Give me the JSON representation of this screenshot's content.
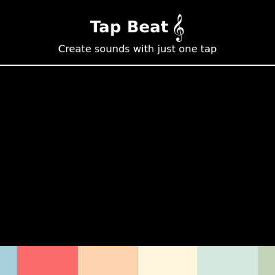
{
  "header": {
    "title": "Tap Beat",
    "clef_glyph": "𝄞",
    "clef_icon": "treble-clef-icon",
    "subtitle": "Create sounds with just one tap"
  },
  "colors": {
    "background": "#000000",
    "text": "#ffffff",
    "divider": "#ffffff",
    "pads": [
      "#a8d0dc",
      "#fb6b6b",
      "#fed3b0",
      "#fff6dd",
      "#d5e8df",
      "#c3d4b8"
    ]
  }
}
